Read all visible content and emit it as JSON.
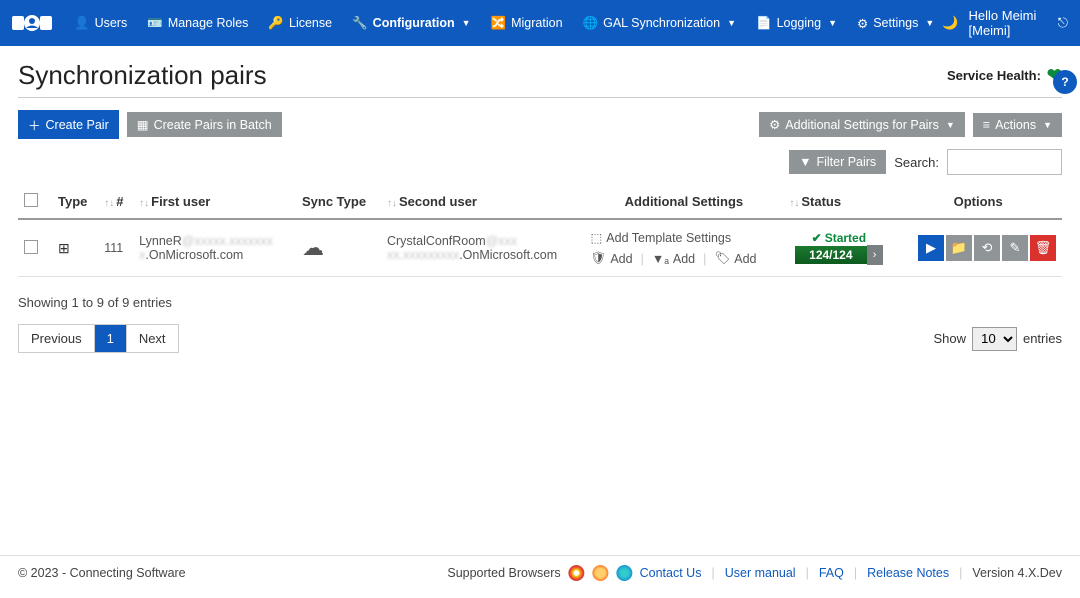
{
  "nav": {
    "users": "Users",
    "manage_roles": "Manage Roles",
    "license": "License",
    "configuration": "Configuration",
    "migration": "Migration",
    "gal_sync": "GAL Synchronization",
    "logging": "Logging",
    "settings": "Settings",
    "hello": "Hello Meimi [Meimi]"
  },
  "page": {
    "title": "Synchronization pairs",
    "service_health": "Service Health:"
  },
  "toolbar": {
    "create_pair": "Create Pair",
    "create_batch": "Create Pairs in Batch",
    "additional_settings": "Additional Settings for Pairs",
    "actions": "Actions",
    "filter_pairs": "Filter Pairs",
    "search_label": "Search:"
  },
  "table": {
    "headers": {
      "type": "Type",
      "num": "#",
      "first_user": "First user",
      "sync_type": "Sync Type",
      "second_user": "Second user",
      "additional": "Additional Settings",
      "status": "Status",
      "options": "Options"
    },
    "row": {
      "num": "111",
      "first_user_a": "LynneR",
      "first_user_b": ".OnMicrosoft.com",
      "second_user_a": "CrystalConfRoom",
      "second_user_b": ".OnMicrosoft.com",
      "add_template": "Add Template Settings",
      "add": "Add",
      "status_label": "Started",
      "progress": "124/124"
    }
  },
  "entries_info": "Showing 1 to 9 of 9 entries",
  "pager": {
    "prev": "Previous",
    "p1": "1",
    "next": "Next"
  },
  "show": {
    "label_a": "Show",
    "value": "10",
    "label_b": "entries"
  },
  "footer": {
    "copyright": "© 2023 - Connecting Software",
    "supported": "Supported Browsers",
    "contact": "Contact Us",
    "manual": "User manual",
    "faq": "FAQ",
    "notes": "Release Notes",
    "version": "Version 4.X.Dev"
  }
}
